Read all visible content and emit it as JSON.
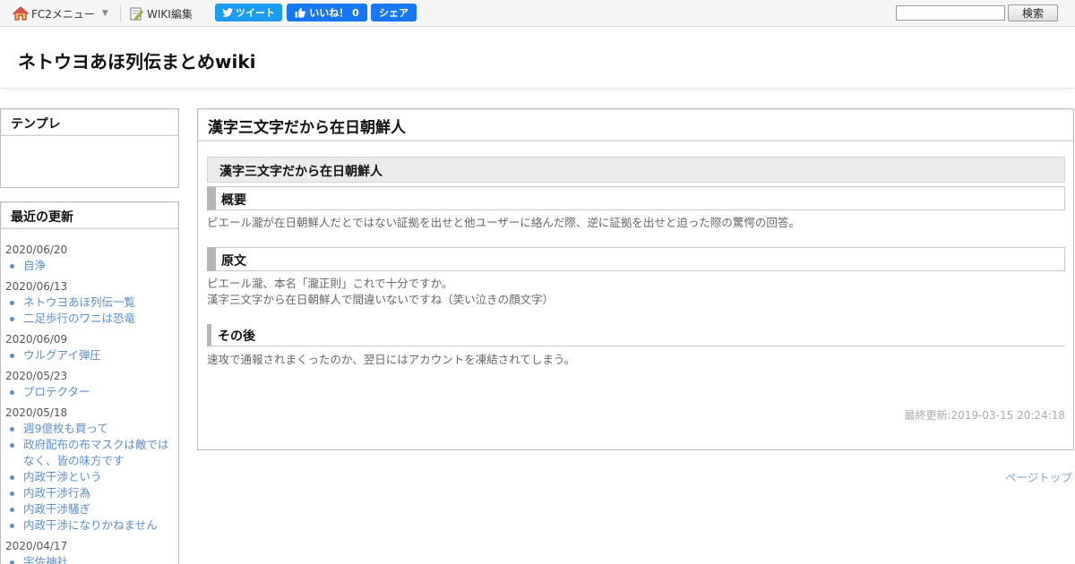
{
  "topbar": {
    "fc2_menu_label": "FC2メニュー",
    "wiki_edit_label": "WIKI編集",
    "tweet_label": "ツイート",
    "like_label": "いいね！ 0",
    "share_label": "シェア",
    "search_value": "",
    "search_button_label": "検索"
  },
  "header": {
    "site_title": "ネトウヨあほ列伝まとめwiki"
  },
  "sidebar": {
    "template_title": "テンプレ",
    "recent_title": "最近の更新",
    "recent": [
      {
        "date": "2020/06/20",
        "items": [
          "自浄"
        ]
      },
      {
        "date": "2020/06/13",
        "items": [
          "ネトウヨあほ列伝一覧",
          "二足歩行のワニは恐竜"
        ]
      },
      {
        "date": "2020/06/09",
        "items": [
          "ウルグアイ弾圧"
        ]
      },
      {
        "date": "2020/05/23",
        "items": [
          "プロテクター"
        ]
      },
      {
        "date": "2020/05/18",
        "items": [
          "週9億枚も買って",
          "政府配布の布マスクは敵ではなく、皆の味方です",
          "内政干渉という",
          "内政干渉行為",
          "内政干渉騒ぎ",
          "内政干渉になりかねません"
        ]
      },
      {
        "date": "2020/04/17",
        "items": [
          "宇佐神社"
        ]
      }
    ]
  },
  "main": {
    "page_title": "漢字三文字だから在日朝鮮人",
    "heading": "漢字三文字だから在日朝鮮人",
    "section_overview": "概要",
    "overview_text": "ピエール瀧が在日朝鮮人だとではない証拠を出せと他ユーザーに絡んだ際、逆に証拠を出せと迫った際の驚愕の回答。",
    "section_original": "原文",
    "original_line1": "ピエール瀧、本名「瀧正則」これで十分ですか。",
    "original_line2": "漢字三文字から在日朝鮮人で間違いないですね（笑い泣きの顔文字）",
    "section_after": "その後",
    "after_text": "速攻で通報されまくったのか、翌日にはアカウントを凍結されてしまう。",
    "last_modified": "最終更新:2019-03-15 20:24:18"
  },
  "footer": {
    "page_top_label": "ページトップ"
  }
}
